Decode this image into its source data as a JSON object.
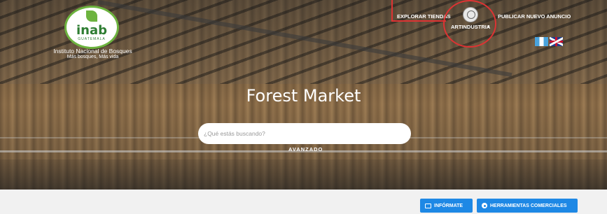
{
  "brand": {
    "logo_word": "inab",
    "logo_sub": "GUATEMALA",
    "org_name": "Instituto Nacional de Bosques",
    "tagline": "Más bosques, Más vida"
  },
  "nav": {
    "explorar": "EXPLORAR TIENDAS",
    "user": "ARTINDUSTRIA",
    "publicar": "PUBLICAR NUEVO ANUNCIO"
  },
  "flags": {
    "guatemala_color": "#49a3dd",
    "uk_color": "#1f3d8c"
  },
  "hero": {
    "title": "Forest Market",
    "search_placeholder": "¿Qué estás buscando?",
    "advanced": "AVANZADO"
  },
  "actions": {
    "informate": "INFÓRMATE",
    "herramientas": "HERRAMIENTAS COMERCIALES"
  },
  "colors": {
    "accent": "#1e88e5",
    "highlight": "#dd3333"
  }
}
